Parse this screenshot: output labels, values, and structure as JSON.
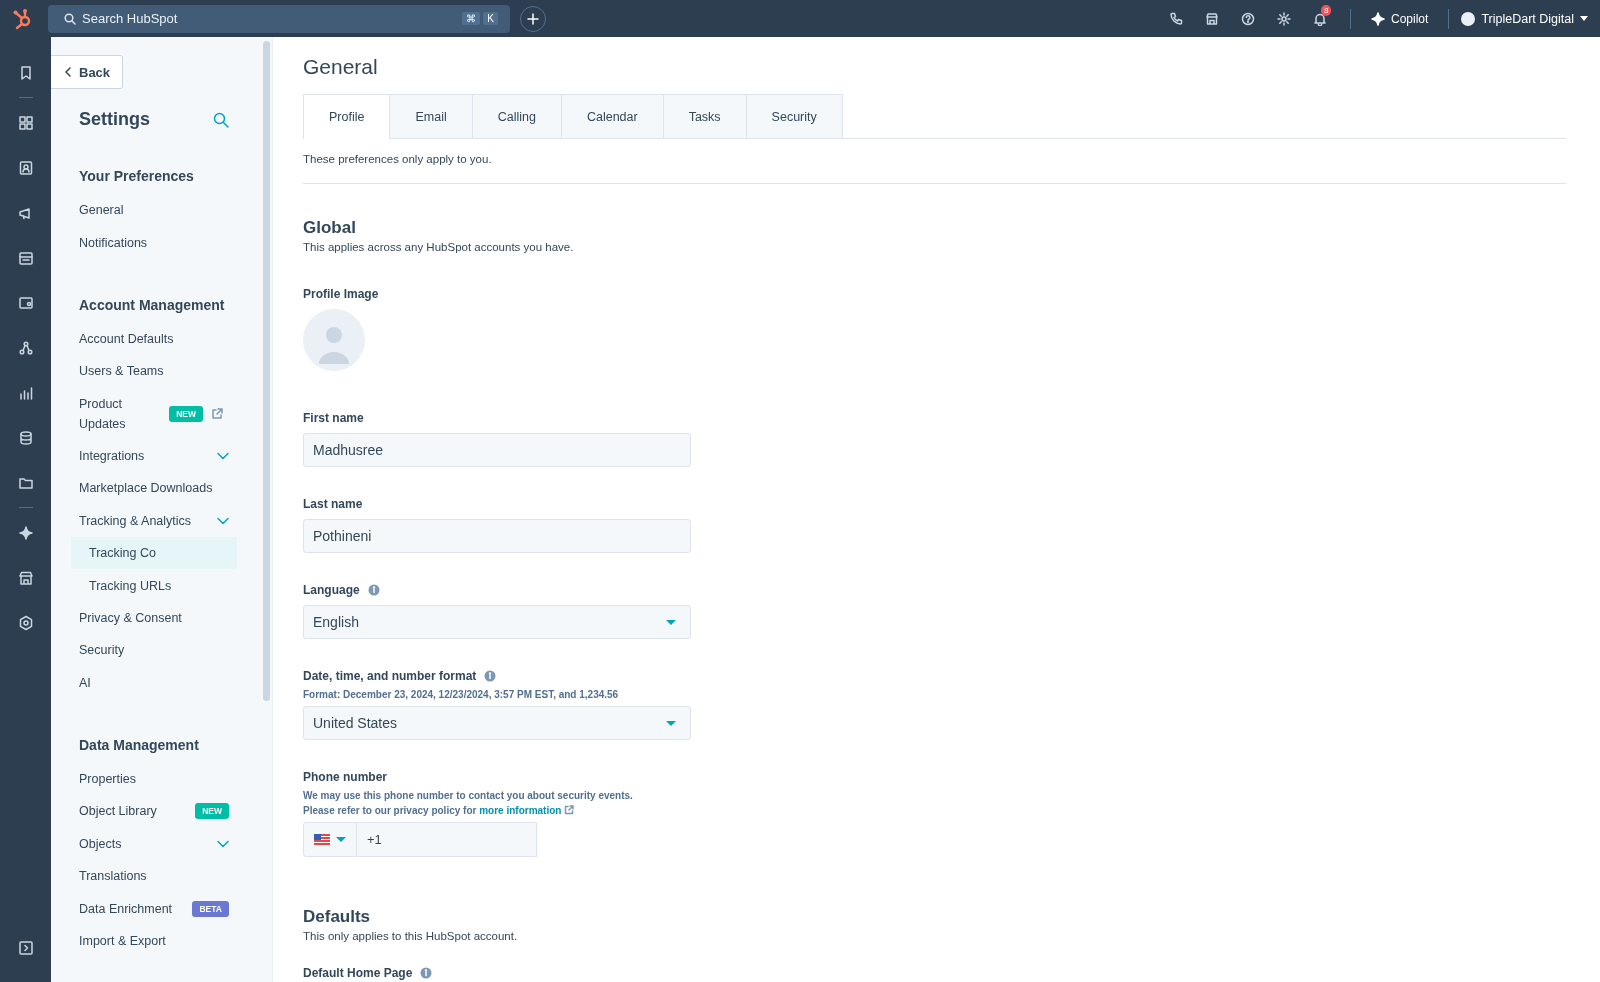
{
  "topbar": {
    "search": {
      "placeholder": "Search HubSpot",
      "keys": [
        "⌘",
        "K"
      ]
    },
    "notification_count": "8",
    "copilot": "Copilot",
    "account": "TripleDart Digital"
  },
  "sidebar": {
    "back": "Back",
    "title": "Settings",
    "sections": [
      {
        "heading": "Your Preferences",
        "items": [
          {
            "label": "General",
            "kind": "link",
            "selected": false
          },
          {
            "label": "Notifications",
            "kind": "link",
            "selected": false
          }
        ]
      },
      {
        "heading": "Account Management",
        "items": [
          {
            "label": "Account Defaults",
            "kind": "link",
            "selected": false
          },
          {
            "label": "Users & Teams",
            "kind": "link",
            "selected": false
          },
          {
            "label": "Product Updates",
            "kind": "external",
            "selected": false,
            "badge": {
              "text": "NEW",
              "color": "#00bda5"
            }
          },
          {
            "label": "Integrations",
            "kind": "group",
            "selected": false
          },
          {
            "label": "Marketplace Downloads",
            "kind": "link",
            "selected": false
          },
          {
            "label": "Tracking & Analytics",
            "kind": "group",
            "selected": false,
            "children": [
              {
                "label": "Tracking Co",
                "kind": "link",
                "selected": true
              },
              {
                "label": "Tracking URLs",
                "kind": "link",
                "selected": false
              }
            ]
          },
          {
            "label": "Privacy & Consent",
            "kind": "link",
            "selected": false
          },
          {
            "label": "Security",
            "kind": "link",
            "selected": false
          },
          {
            "label": "AI",
            "kind": "link",
            "selected": false
          }
        ]
      },
      {
        "heading": "Data Management",
        "items": [
          {
            "label": "Properties",
            "kind": "link",
            "selected": false
          },
          {
            "label": "Object Library",
            "kind": "link",
            "selected": false,
            "badge": {
              "text": "NEW",
              "color": "#00bda5"
            }
          },
          {
            "label": "Objects",
            "kind": "group",
            "selected": false
          },
          {
            "label": "Translations",
            "kind": "link",
            "selected": false
          },
          {
            "label": "Data Enrichment",
            "kind": "link",
            "selected": false,
            "badge": {
              "text": "BETA",
              "color": "#6a78d1"
            }
          },
          {
            "label": "Import & Export",
            "kind": "link",
            "selected": false
          }
        ]
      }
    ]
  },
  "main": {
    "title": "General",
    "tabs": [
      {
        "label": "Profile",
        "selected": true
      },
      {
        "label": "Email",
        "selected": false
      },
      {
        "label": "Calling",
        "selected": false
      },
      {
        "label": "Calendar",
        "selected": false
      },
      {
        "label": "Tasks",
        "selected": false
      },
      {
        "label": "Security",
        "selected": false
      }
    ],
    "intro": "These preferences only apply to you.",
    "sections": [
      {
        "heading": "Global",
        "description": "This applies across any HubSpot accounts you have.",
        "fields": [
          {
            "label": "Profile Image",
            "kind": "image"
          },
          {
            "label": "First name",
            "kind": "text",
            "value": "Madhusree"
          },
          {
            "label": "Last name",
            "kind": "text",
            "value": "Pothineni"
          },
          {
            "label": "Language",
            "kind": "select",
            "info": true,
            "value": "English"
          },
          {
            "label": "Date, time, and number format",
            "kind": "select",
            "info": true,
            "hints": [
              "Format: December 23, 2024, 12/23/2024, 3:57 PM EST, and 1,234.56"
            ],
            "value": "United States"
          },
          {
            "label": "Phone number",
            "kind": "phone",
            "hints": [
              "We may use this phone number to contact you about security events.",
              "Please refer to our privacy policy for"
            ],
            "link": "more information",
            "value": "+1"
          }
        ]
      },
      {
        "heading": "Defaults",
        "description": "This only applies to this HubSpot account.",
        "fields": [
          {
            "label": "Default Home Page",
            "info": true
          }
        ]
      }
    ]
  }
}
